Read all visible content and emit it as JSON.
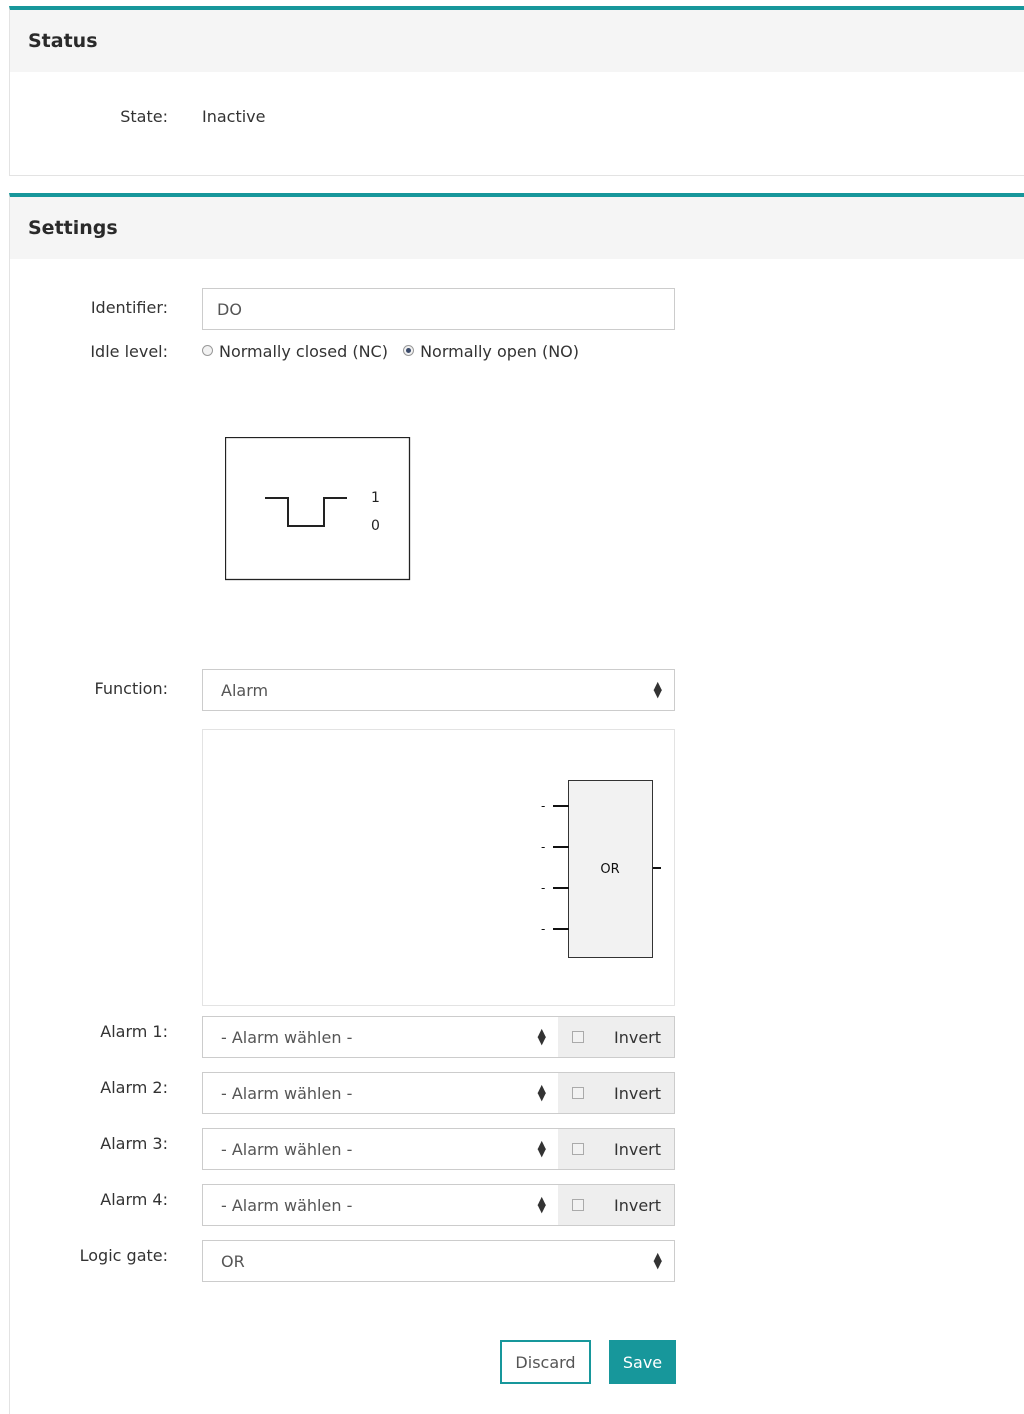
{
  "status": {
    "title": "Status",
    "state_label": "State:",
    "state_value": "Inactive"
  },
  "settings": {
    "title": "Settings",
    "identifier_label": "Identifier:",
    "identifier_value": "DO",
    "idle_level_label": "Idle level:",
    "idle_options": [
      "Normally closed (NC)",
      "Normally open (NO)"
    ],
    "idle_selected": "Normally open (NO)",
    "signal_diagram": {
      "high_label": "1",
      "low_label": "0"
    },
    "function_label": "Function:",
    "function_value": "Alarm",
    "gate_diagram": {
      "gate_label": "OR",
      "input_labels": [
        "-",
        "-",
        "-",
        "-"
      ]
    },
    "alarms": [
      {
        "label": "Alarm 1:",
        "value": "- Alarm wählen -",
        "invert_label": "Invert",
        "invert_checked": false
      },
      {
        "label": "Alarm 2:",
        "value": "- Alarm wählen -",
        "invert_label": "Invert",
        "invert_checked": false
      },
      {
        "label": "Alarm 3:",
        "value": "- Alarm wählen -",
        "invert_label": "Invert",
        "invert_checked": false
      },
      {
        "label": "Alarm 4:",
        "value": "- Alarm wählen -",
        "invert_label": "Invert",
        "invert_checked": false
      }
    ],
    "logic_gate_label": "Logic gate:",
    "logic_gate_value": "OR",
    "discard_label": "Discard",
    "save_label": "Save"
  },
  "colors": {
    "accent": "#17979b",
    "panel_header_bg": "#f5f5f5",
    "border": "#cccccc"
  }
}
